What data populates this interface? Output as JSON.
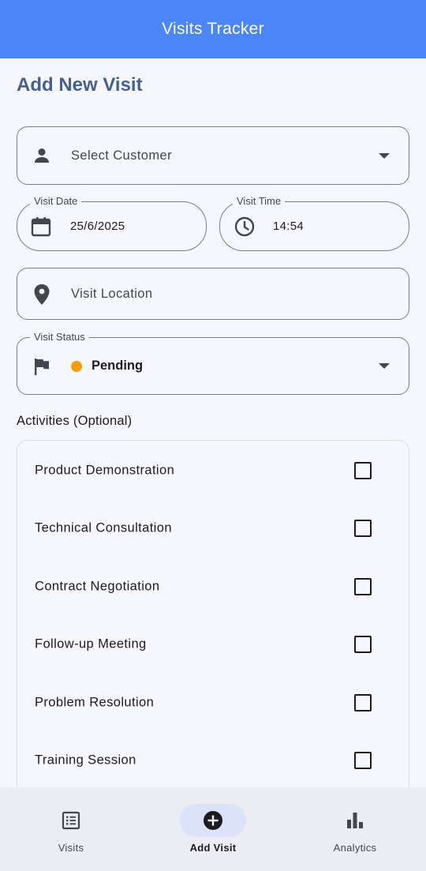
{
  "app_bar": {
    "title": "Visits Tracker",
    "color": "#4a86f7"
  },
  "page": {
    "title": "Add New Visit"
  },
  "form": {
    "customer": {
      "placeholder": "Select Customer",
      "icon": "person-icon"
    },
    "visit_date": {
      "label": "Visit Date",
      "value": "25/6/2025",
      "icon": "calendar-icon"
    },
    "visit_time": {
      "label": "Visit Time",
      "value": "14:54",
      "icon": "clock-icon"
    },
    "location": {
      "placeholder": "Visit Location",
      "icon": "location-pin-icon"
    },
    "status": {
      "label": "Visit Status",
      "value": "Pending",
      "dot_color": "#f59e0b",
      "icon": "flag-icon"
    }
  },
  "activities": {
    "title": "Activities (Optional)",
    "items": [
      {
        "label": "Product Demonstration",
        "checked": false
      },
      {
        "label": "Technical Consultation",
        "checked": false
      },
      {
        "label": "Contract Negotiation",
        "checked": false
      },
      {
        "label": "Follow-up Meeting",
        "checked": false
      },
      {
        "label": "Problem Resolution",
        "checked": false
      },
      {
        "label": "Training Session",
        "checked": false
      }
    ]
  },
  "bottom_nav": {
    "items": [
      {
        "label": "Visits",
        "icon": "list-icon",
        "active": false
      },
      {
        "label": "Add Visit",
        "icon": "add-circle-icon",
        "active": true
      },
      {
        "label": "Analytics",
        "icon": "bar-chart-icon",
        "active": false
      }
    ]
  }
}
